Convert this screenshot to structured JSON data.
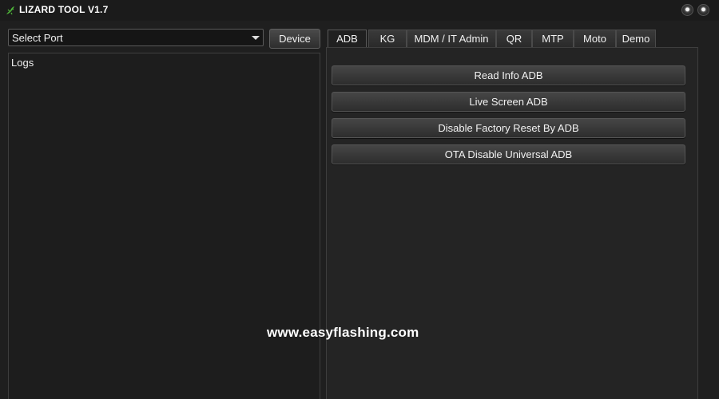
{
  "window": {
    "title": "LIZARD TOOL V1.7",
    "logo_icon": "lizard-icon",
    "accent": "#4fb83a"
  },
  "port": {
    "selected": "Select Port",
    "icon": "chevron-down-icon"
  },
  "device_button": {
    "label": "Device"
  },
  "logs": {
    "label": "Logs"
  },
  "tabs": [
    {
      "label": "ADB",
      "active": true
    },
    {
      "label": "KG"
    },
    {
      "label": "MDM / IT Admin"
    },
    {
      "label": "QR"
    },
    {
      "label": "MTP"
    },
    {
      "label": "Moto"
    },
    {
      "label": "Demo"
    }
  ],
  "adb_actions": [
    {
      "label": "Read Info ADB"
    },
    {
      "label": "Live Screen ADB"
    },
    {
      "label": "Disable Factory Reset By ADB"
    },
    {
      "label": "OTA Disable Universal ADB"
    }
  ],
  "watermark": "www.easyflashing.com"
}
